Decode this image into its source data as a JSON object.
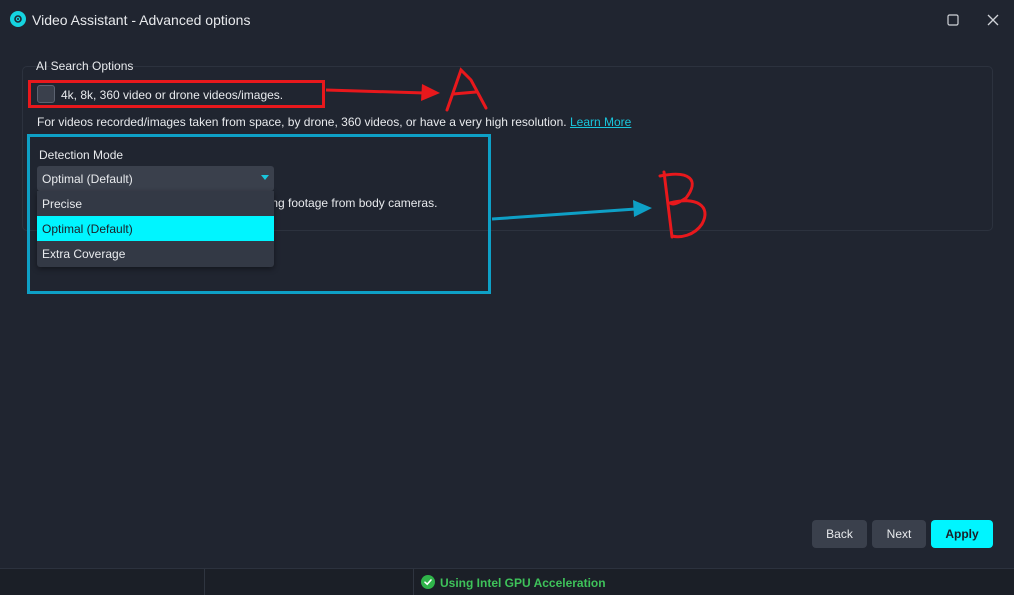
{
  "window": {
    "title": "Video Assistant - Advanced options",
    "icon": "video-assistant-logo-icon",
    "maximize_icon": "maximize-icon",
    "close_icon": "close-icon"
  },
  "ai_search": {
    "group_title": "AI Search Options",
    "checkbox_label": "4k, 8k, 360 video or drone videos/images.",
    "checkbox_checked": false,
    "description": "For videos recorded/images taken from space, by drone, 360 videos, or have a very high resolution.",
    "learn_more": "Learn More",
    "partial_text": "ding footage from body cameras."
  },
  "detection_mode": {
    "label": "Detection Mode",
    "selected": "Optimal (Default)",
    "options": [
      "Precise",
      "Optimal (Default)",
      "Extra Coverage"
    ]
  },
  "annotations": {
    "a_letter": "A",
    "b_letter": "B",
    "a_color": "#e8181c",
    "b_color": "#0ea0c6"
  },
  "buttons": {
    "back": "Back",
    "next": "Next",
    "apply": "Apply"
  },
  "status": {
    "gpu_text": "Using Intel GPU Acceleration",
    "gpu_icon": "check-circle-icon"
  },
  "colors": {
    "accent": "#00f5ff",
    "background": "#202530",
    "status_ok": "#3ec25a"
  }
}
